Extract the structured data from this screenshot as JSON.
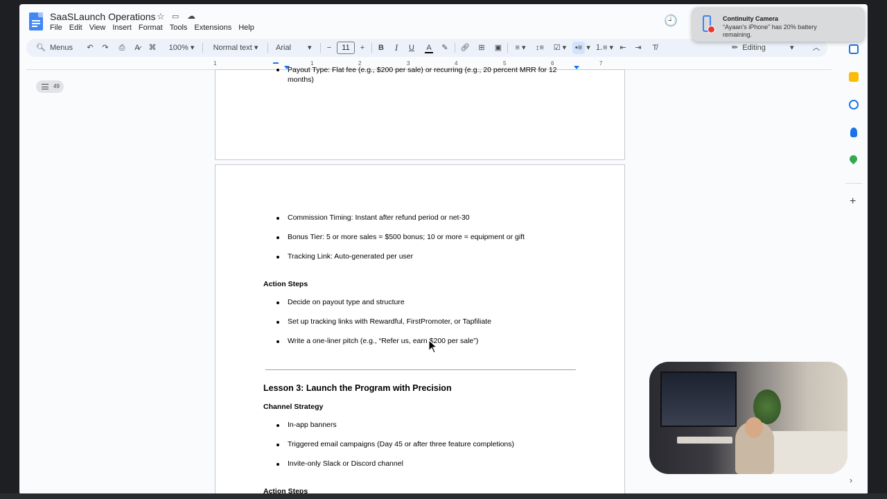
{
  "doc": {
    "title": "SaaSLaunch Operations",
    "menu": [
      "File",
      "Edit",
      "View",
      "Insert",
      "Format",
      "Tools",
      "Extensions",
      "Help"
    ]
  },
  "toolbar": {
    "menus_label": "Menus",
    "zoom": "100%",
    "style": "Normal text",
    "font": "Arial",
    "font_size": "11",
    "mode": "Editing"
  },
  "notification": {
    "title": "Continuity Camera",
    "body": "“Ayaan’s iPhone” has 20% battery remaining."
  },
  "outline": {
    "count": "49"
  },
  "ruler": [
    "1",
    "1",
    "2",
    "3",
    "4",
    "5",
    "6",
    "7"
  ],
  "page1": {
    "line1": "Payout Type: Flat fee (e.g., $200 per sale) or recurring (e.g., 20 percent MRR for 12",
    "line2": "months)"
  },
  "page2": {
    "bullets1": [
      "Commission Timing: Instant after refund period or net-30",
      "Bonus Tier: 5 or more sales = $500 bonus; 10 or more = equipment or gift",
      "Tracking Link: Auto-generated per user"
    ],
    "action_steps_heading": "Action Steps",
    "bullets2": [
      "Decide on payout type and structure",
      "Set up tracking links with Rewardful, FirstPromoter, or Tapfiliate",
      "Write a one-liner pitch (e.g., “Refer us, earn $200 per sale”)"
    ],
    "lesson_heading": "Lesson 3: Launch the Program with Precision",
    "channel_heading": "Channel Strategy",
    "bullets3": [
      "In-app banners",
      "Triggered email campaigns (Day 45 or after three feature completions)",
      "Invite-only Slack or Discord channel"
    ],
    "action_steps_heading2": "Action Steps"
  },
  "colors": {
    "accent": "#1a73e8",
    "toolbar_bg": "#edf2fa",
    "doc_blue": "#4285f4"
  }
}
